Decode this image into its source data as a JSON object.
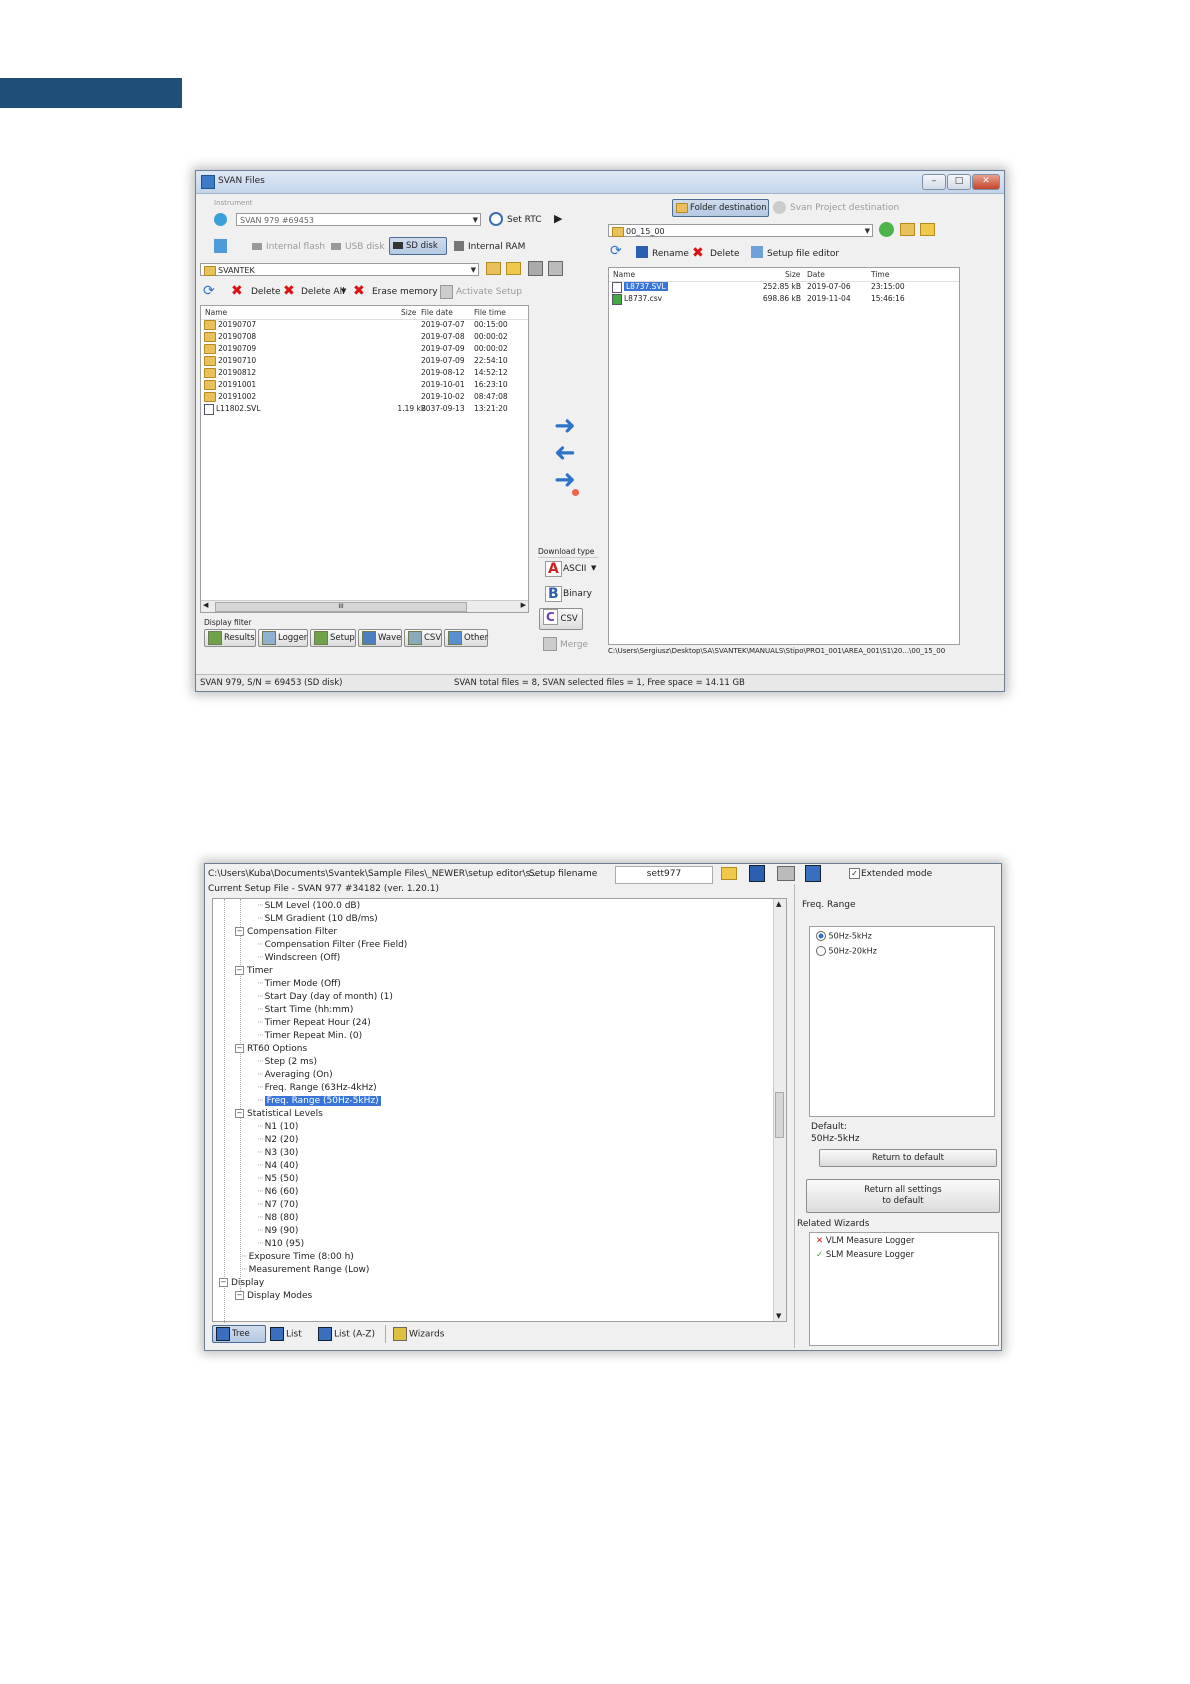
{
  "svan": {
    "title": "SVAN Files",
    "instrument_label": "Instrument",
    "instrument_value": "SVAN 979 #69453",
    "set_rtc": "Set RTC",
    "storage": {
      "internal_flash": "Internal flash",
      "usb_disk": "USB disk",
      "sd_disk": "SD disk",
      "internal_ram": "Internal RAM"
    },
    "left_folder": "SVANTEK",
    "actions": {
      "delete": "Delete",
      "delete_all": "Delete All",
      "erase_memory": "Erase memory",
      "activate_setup": "Activate Setup"
    },
    "left_headers": {
      "name": "Name",
      "size": "Size",
      "date": "File date",
      "time": "File time"
    },
    "left_rows": [
      {
        "name": "20190707",
        "size": "",
        "date": "2019-07-07",
        "time": "00:15:00"
      },
      {
        "name": "20190708",
        "size": "",
        "date": "2019-07-08",
        "time": "00:00:02"
      },
      {
        "name": "20190709",
        "size": "",
        "date": "2019-07-09",
        "time": "00:00:02"
      },
      {
        "name": "20190710",
        "size": "",
        "date": "2019-07-09",
        "time": "22:54:10"
      },
      {
        "name": "20190812",
        "size": "",
        "date": "2019-08-12",
        "time": "14:52:12"
      },
      {
        "name": "20191001",
        "size": "",
        "date": "2019-10-01",
        "time": "16:23:10"
      },
      {
        "name": "20191002",
        "size": "",
        "date": "2019-10-02",
        "time": "08:47:08"
      },
      {
        "name": "L11802.SVL",
        "size": "1.19 kB",
        "date": "2037-09-13",
        "time": "13:21:20"
      }
    ],
    "display_filter_label": "Display filter",
    "filters": {
      "results": "Results",
      "logger": "Logger",
      "setup": "Setup",
      "wave": "Wave",
      "csv": "CSV",
      "other": "Other"
    },
    "download_type_label": "Download type",
    "download": {
      "ascii": "ASCII",
      "binary": "Binary",
      "csv": "CSV",
      "merge": "Merge"
    },
    "folder_destination": "Folder destination",
    "svan_project_destination": "Svan Project destination",
    "right_folder": "00_15_00",
    "right_actions": {
      "rename": "Rename",
      "delete": "Delete",
      "setup_file_editor": "Setup file editor"
    },
    "right_headers": {
      "name": "Name",
      "size": "Size",
      "date": "Date",
      "time": "Time"
    },
    "right_rows": [
      {
        "name": "L8737.SVL",
        "size": "252.85 kB",
        "date": "2019-07-06",
        "time": "23:15:00"
      },
      {
        "name": "L8737.csv",
        "size": "698.86 kB",
        "date": "2019-11-04",
        "time": "15:46:16"
      }
    ],
    "path": "C:\\Users\\Sergiusz\\Desktop\\SA\\SVANTEK\\MANUALS\\Stipo\\PRO1_001\\AREA_001\\S1\\20...\\00_15_00",
    "status_left": "SVAN 979, S/N = 69453 (SD disk)",
    "status_right": "SVAN total files = 8, SVAN selected files = 1, Free space = 14.11 GB",
    "h_scroll_mark": "III"
  },
  "setup": {
    "path": "C:\\Users\\Kuba\\Documents\\Svantek\\Sample Files\\_NEWER\\setup editor\\s...",
    "setup_filename_label": "Setup filename",
    "setup_filename_value": "sett977",
    "extended_mode": "Extended mode",
    "current_setup": "Current Setup File  - SVAN 977 #34182 (ver. 1.20.1)",
    "tree": [
      "SLM Level (100.0 dB)",
      "SLM Gradient (10 dB/ms)",
      "Compensation Filter",
      "Compensation Filter (Free Field)",
      "Windscreen (Off)",
      "Timer",
      "Timer Mode (Off)",
      "Start Day (day of month) (1)",
      "Start Time (hh:mm)",
      "Timer Repeat Hour (24)",
      "Timer Repeat Min. (0)",
      "RT60 Options",
      "Step (2 ms)",
      "Averaging (On)",
      "Freq. Range (63Hz-4kHz)",
      "Freq. Range (50Hz-5kHz)",
      "Statistical Levels",
      "N1 (10)",
      "N2 (20)",
      "N3 (30)",
      "N4 (40)",
      "N5 (50)",
      "N6 (60)",
      "N7 (70)",
      "N8 (80)",
      "N9 (90)",
      "N10 (95)",
      "Exposure Time (8:00 h)",
      "Measurement Range (Low)",
      "Display",
      "Display Modes"
    ],
    "views": {
      "tree": "Tree",
      "list": "List",
      "list_az": "List (A-Z)",
      "wizards": "Wizards"
    },
    "freq_range_label": "Freq. Range",
    "options": [
      "50Hz-5kHz",
      "50Hz-20kHz"
    ],
    "default_label": "Default:",
    "default_value": "50Hz-5kHz",
    "return_to_default": "Return to default",
    "return_all_line1": "Return all settings",
    "return_all_line2": "to default",
    "related_wizards_label": "Related Wizards",
    "wizards": [
      "VLM Measure Logger",
      "SLM Measure Logger"
    ]
  },
  "colors": {
    "band": "#1f4e79",
    "selection": "#3875d7",
    "arrow": "#2d74c8",
    "error": "#d11111",
    "ok": "#2ea52e"
  }
}
